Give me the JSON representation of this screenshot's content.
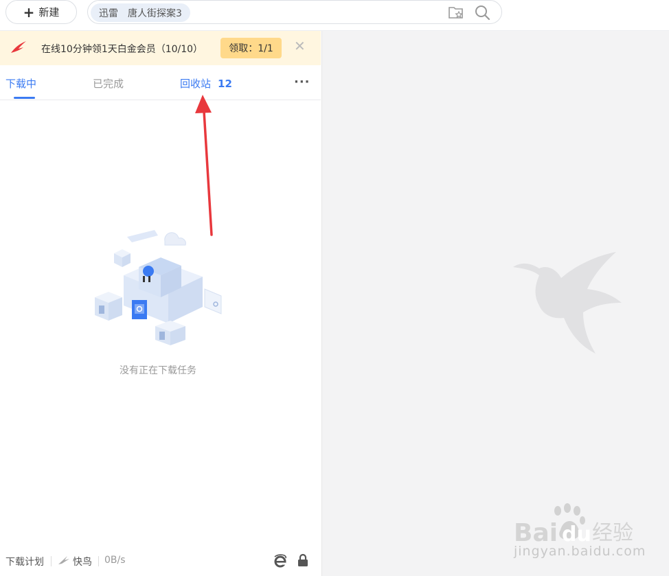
{
  "toolbar": {
    "new_label": "新建",
    "search_chip_app": "迅雷",
    "search_chip_query": "唐人街探案3"
  },
  "banner": {
    "text": "在线10分钟领1天白金会员（10/10）",
    "claim_label": "领取：1/1",
    "close_glyph": "✕"
  },
  "tabs": {
    "downloading": "下载中",
    "completed": "已完成",
    "recycle": "回收站",
    "recycle_count": "12",
    "more_glyph": "···"
  },
  "empty": {
    "message": "没有正在下载任务"
  },
  "footer": {
    "plan": "下载计划",
    "bird": "快鸟",
    "speed": "0B/s"
  },
  "watermark": {
    "brand_a": "Bai",
    "brand_b": "du",
    "brand_cn": "经验",
    "site": "jingyan.baidu.com"
  },
  "colors": {
    "accent": "#3a7af2",
    "banner_bg": "#fff6e0",
    "claim_bg": "#ffd98a",
    "arrow": "#e8383d"
  }
}
